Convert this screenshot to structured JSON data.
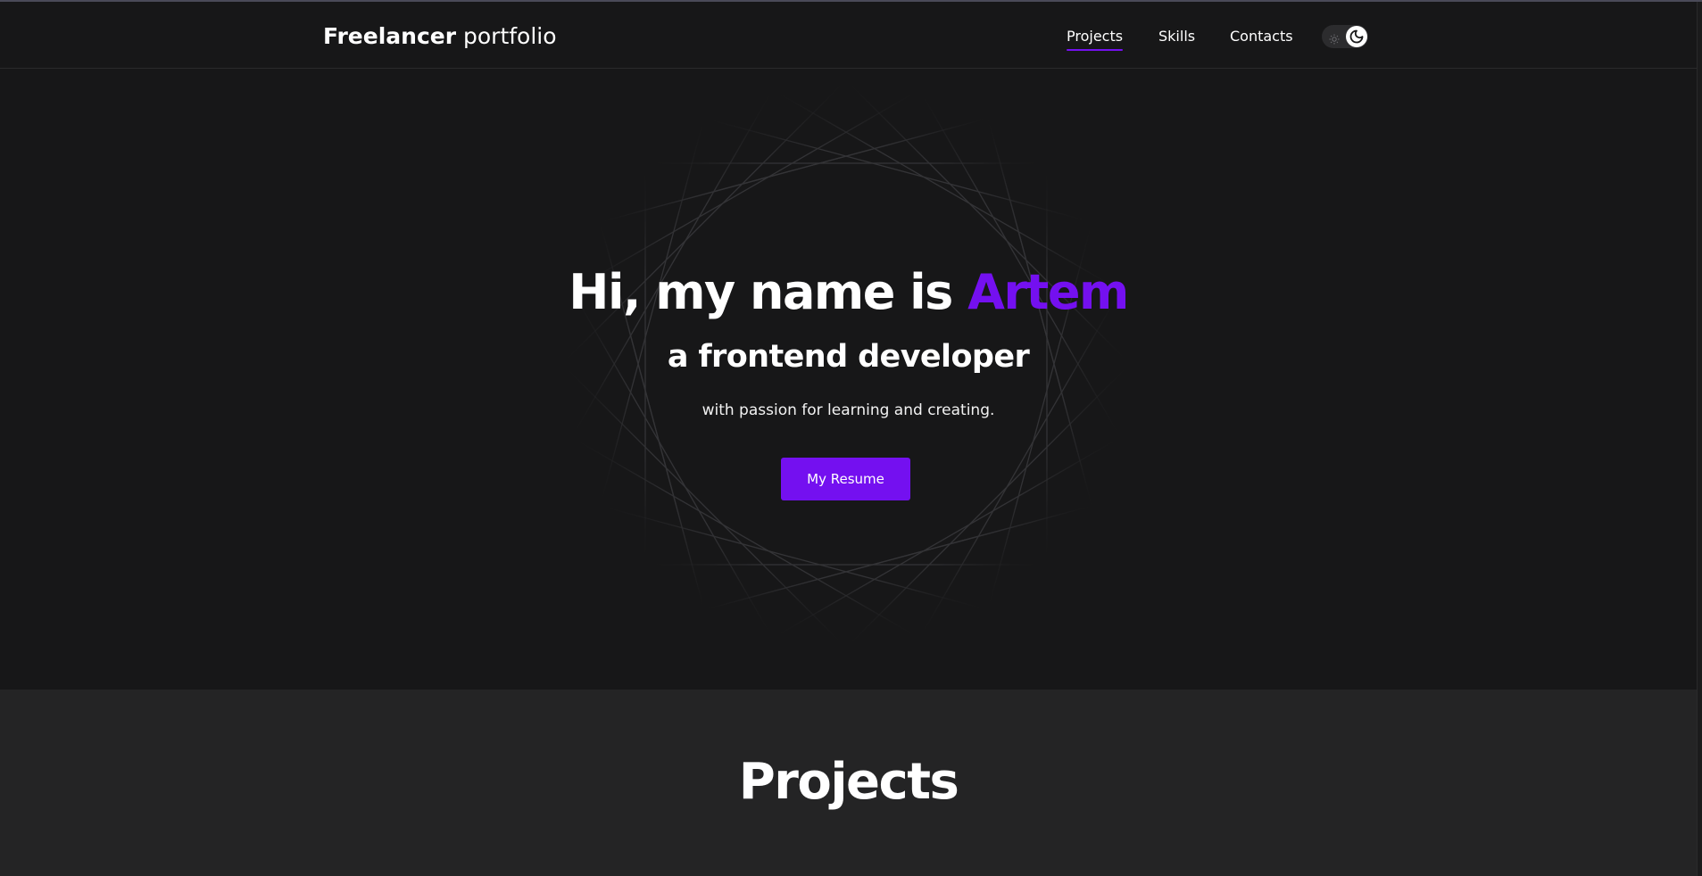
{
  "header": {
    "logo_bold": "Freelancer",
    "logo_light": "portfolio",
    "nav": [
      {
        "label": "Projects",
        "active": true
      },
      {
        "label": "Skills",
        "active": false
      },
      {
        "label": "Contacts",
        "active": false
      }
    ],
    "theme_toggle": {
      "icons": [
        "sun-icon",
        "moon-icon"
      ],
      "state": "dark"
    }
  },
  "hero": {
    "greeting": "Hi, my name is",
    "name": "Artem",
    "subtitle": "a frontend developer",
    "text": "with passion for learning and creating.",
    "button_label": "My Resume"
  },
  "projects": {
    "title": "Projects"
  },
  "colors": {
    "accent": "#7410f0",
    "background": "#171718",
    "section_background": "#242425",
    "text": "#ffffff"
  }
}
